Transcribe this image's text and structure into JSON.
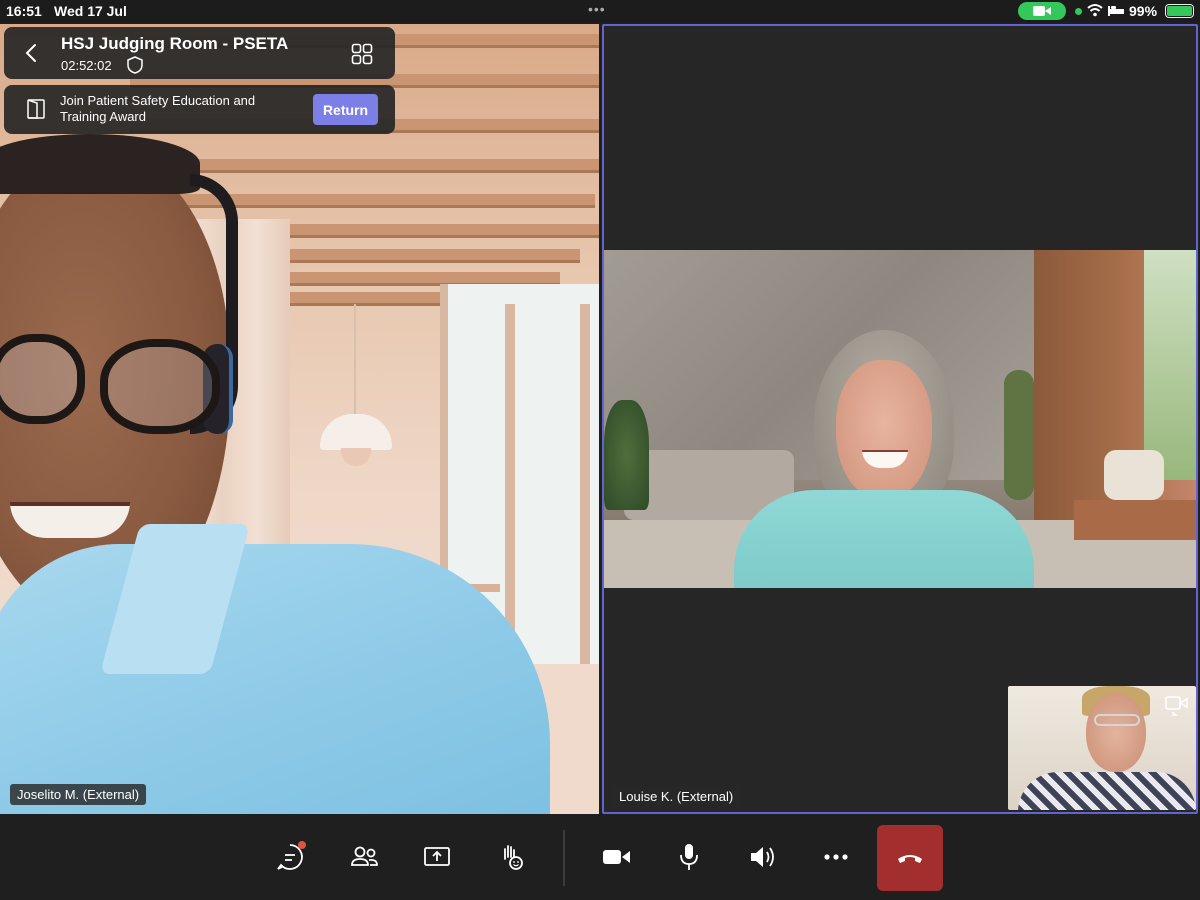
{
  "status_bar": {
    "time": "16:51",
    "date": "Wed 17 Jul",
    "battery_percent": "99%",
    "accent_green": "#34c759"
  },
  "meeting": {
    "title": "HSJ Judging Room - PSETA",
    "timer": "02:52:02",
    "icons": [
      "back-icon",
      "shield-icon",
      "grid-view-icon"
    ]
  },
  "return_banner": {
    "text": "Join Patient Safety Education and Training Award",
    "button_label": "Return",
    "button_color": "#7b7fe6"
  },
  "participants": [
    {
      "name": "Joselito M. (External)"
    },
    {
      "name": "Louise K. (External)",
      "active_speaker_border": "#6264d0"
    }
  ],
  "toolbar": {
    "buttons": [
      "chat-icon",
      "people-icon",
      "share-screen-icon",
      "raise-hand-icon",
      "camera-icon",
      "microphone-icon",
      "speaker-icon",
      "more-icon",
      "hang-up-icon"
    ],
    "hangup_color": "#a32e2e"
  }
}
